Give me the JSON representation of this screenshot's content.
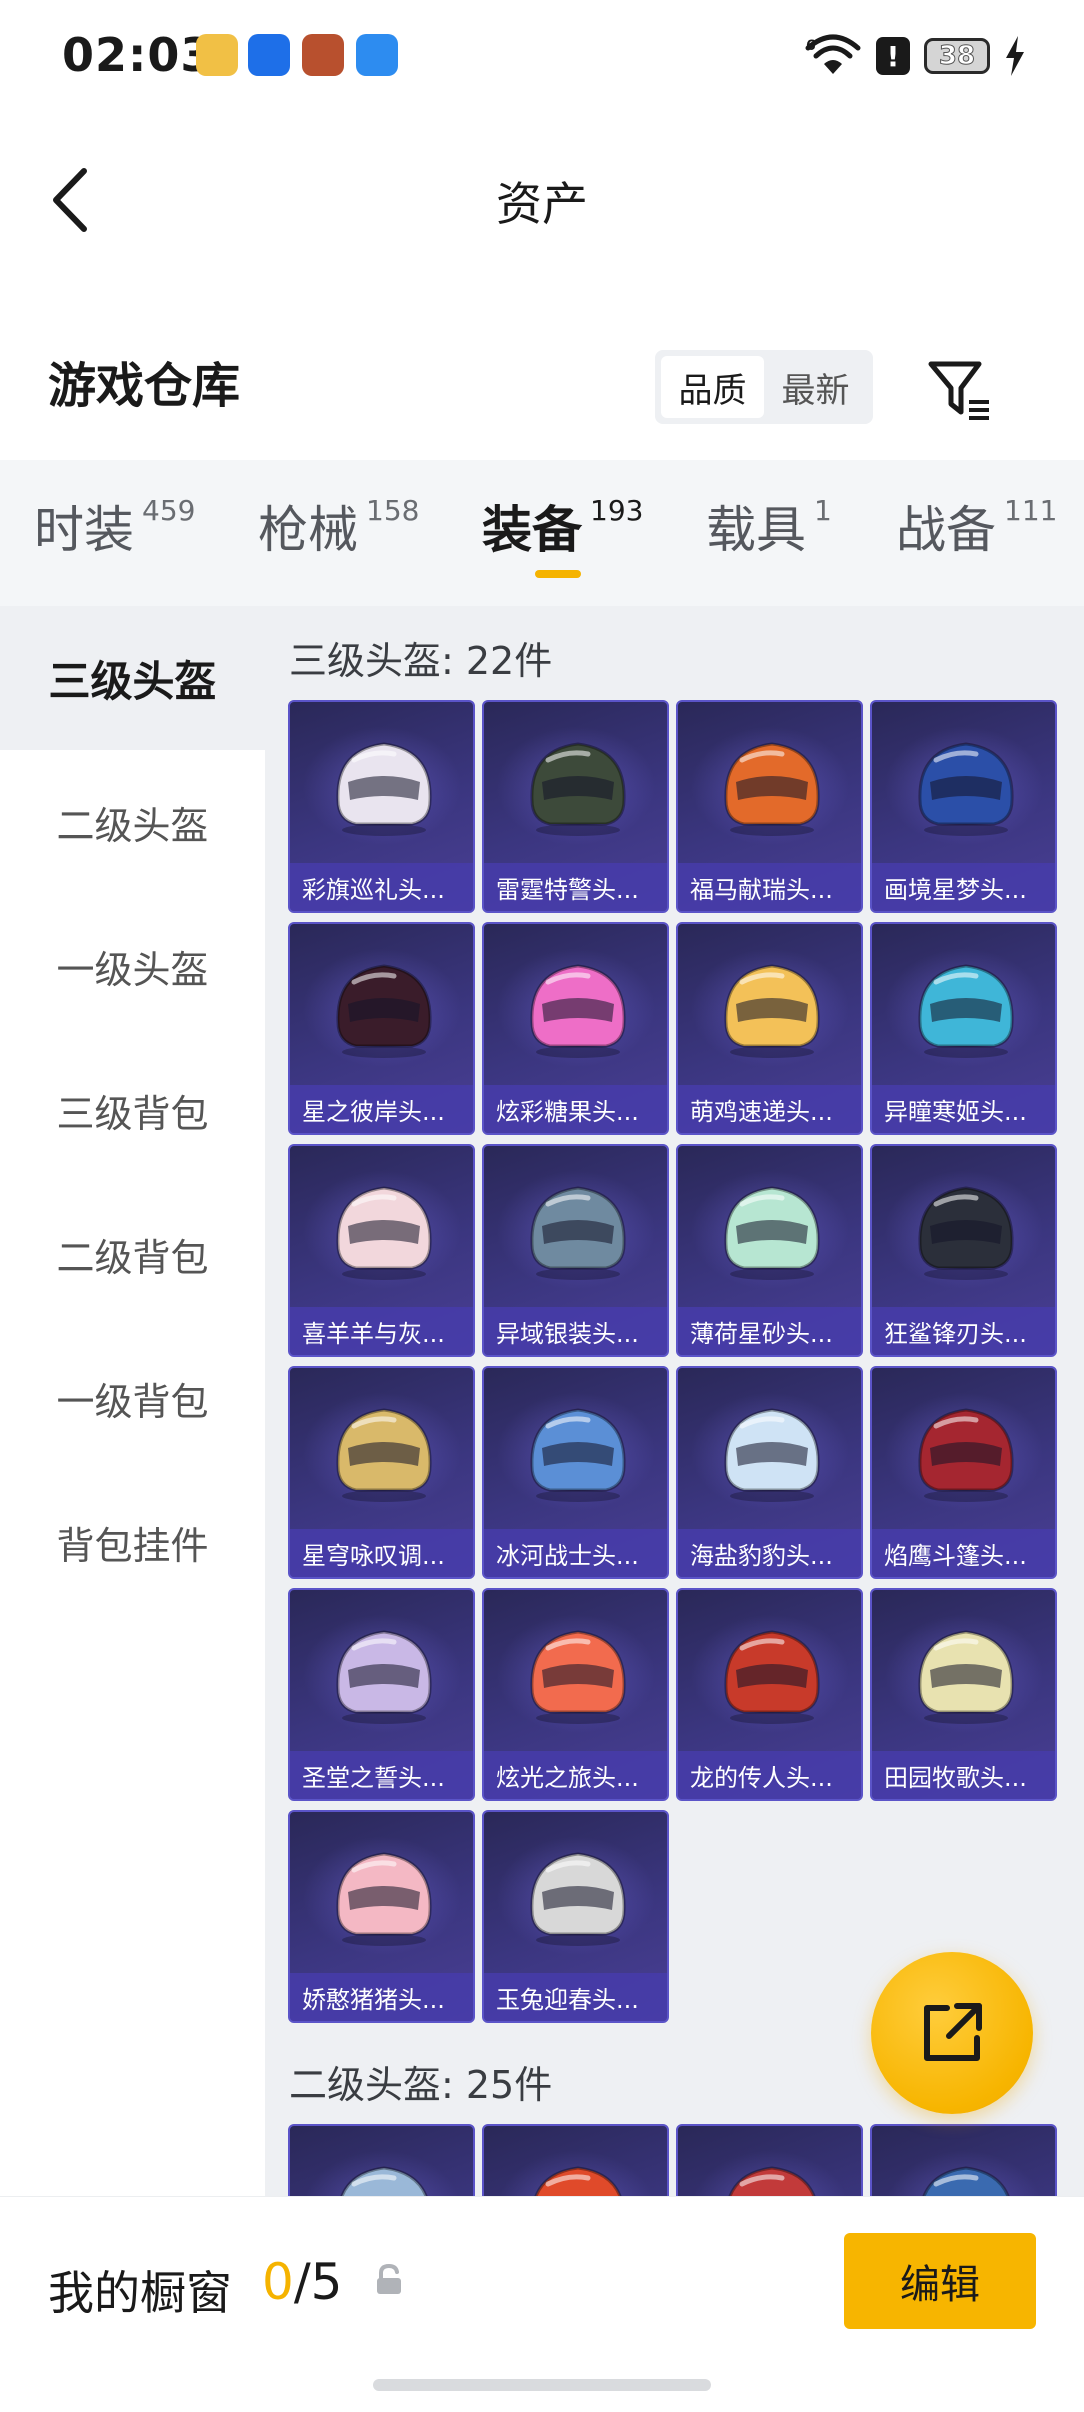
{
  "status_bar": {
    "time": "02:03",
    "signal_label": "6",
    "alert": "!",
    "battery": "38",
    "app_icons": [
      {
        "name": "app-icon-1",
        "color": "#f1c045"
      },
      {
        "name": "app-icon-2",
        "color": "#1e6fe8"
      },
      {
        "name": "app-icon-3",
        "color": "#b8502e"
      },
      {
        "name": "app-icon-4",
        "color": "#2d8cf0"
      }
    ]
  },
  "header": {
    "title": "资产",
    "back_icon": "chevron-left-icon"
  },
  "warehouse": {
    "title": "游戏仓库",
    "sort_options": [
      "品质",
      "最新"
    ],
    "sort_selected": "品质",
    "filter_icon": "filter-icon"
  },
  "tabs": [
    {
      "label": "时装",
      "count": "459",
      "active": false
    },
    {
      "label": "枪械",
      "count": "158",
      "active": false
    },
    {
      "label": "装备",
      "count": "193",
      "active": true
    },
    {
      "label": "载具",
      "count": "1",
      "active": false
    },
    {
      "label": "战备",
      "count": "111",
      "active": false
    }
  ],
  "sidebar": {
    "items": [
      {
        "label": "三级头盔",
        "active": true
      },
      {
        "label": "二级头盔",
        "active": false
      },
      {
        "label": "一级头盔",
        "active": false
      },
      {
        "label": "三级背包",
        "active": false
      },
      {
        "label": "二级背包",
        "active": false
      },
      {
        "label": "一级背包",
        "active": false
      },
      {
        "label": "背包挂件",
        "active": false
      }
    ]
  },
  "sections": [
    {
      "title": "三级头盔: 22件",
      "items": [
        {
          "name": "彩旗巡礼头...",
          "color": "#e9e4ef"
        },
        {
          "name": "雷霆特警头...",
          "color": "#3d4a3a"
        },
        {
          "name": "福马献瑞头...",
          "color": "#e36a2a"
        },
        {
          "name": "画境星梦头...",
          "color": "#2b4fa8"
        },
        {
          "name": "星之彼岸头...",
          "color": "#3a1c2a"
        },
        {
          "name": "炫彩糖果头...",
          "color": "#ee6ec7"
        },
        {
          "name": "萌鸡速递头...",
          "color": "#f3c158"
        },
        {
          "name": "异瞳寒姬头...",
          "color": "#3fb6d8"
        },
        {
          "name": "喜羊羊与灰...",
          "color": "#f2d7dc"
        },
        {
          "name": "异域银装头...",
          "color": "#6f8aa0"
        },
        {
          "name": "薄荷星砂头...",
          "color": "#b7e6d2"
        },
        {
          "name": "狂鲨锋刃头...",
          "color": "#2b2f3a"
        },
        {
          "name": "星穹咏叹调...",
          "color": "#d9b96a"
        },
        {
          "name": "冰河战士头...",
          "color": "#5b8fd6"
        },
        {
          "name": "海盐豹豹头...",
          "color": "#cfe3f5"
        },
        {
          "name": "焰鹰斗篷头...",
          "color": "#a52630"
        },
        {
          "name": "圣堂之誓头...",
          "color": "#c9b8e6"
        },
        {
          "name": "炫光之旅头...",
          "color": "#f26b4e"
        },
        {
          "name": "龙的传人头...",
          "color": "#c83a2a"
        },
        {
          "name": "田园牧歌头...",
          "color": "#e8e2b0"
        },
        {
          "name": "娇憨猪猪头...",
          "color": "#f4b8c4"
        },
        {
          "name": "玉兔迎春头...",
          "color": "#d8d8d8"
        }
      ]
    },
    {
      "title": "二级头盔: 25件",
      "items": [
        {
          "name": "",
          "color": "#9ab8d8"
        },
        {
          "name": "",
          "color": "#e04a2a"
        },
        {
          "name": "",
          "color": "#c23a3a"
        },
        {
          "name": "",
          "color": "#3a6ab0"
        }
      ]
    }
  ],
  "fab": {
    "icon": "share-external-icon"
  },
  "bottom_bar": {
    "label": "我的橱窗",
    "current": "0",
    "separator": "/",
    "total": "5",
    "lock_icon": "lock-icon",
    "edit_label": "编辑"
  }
}
